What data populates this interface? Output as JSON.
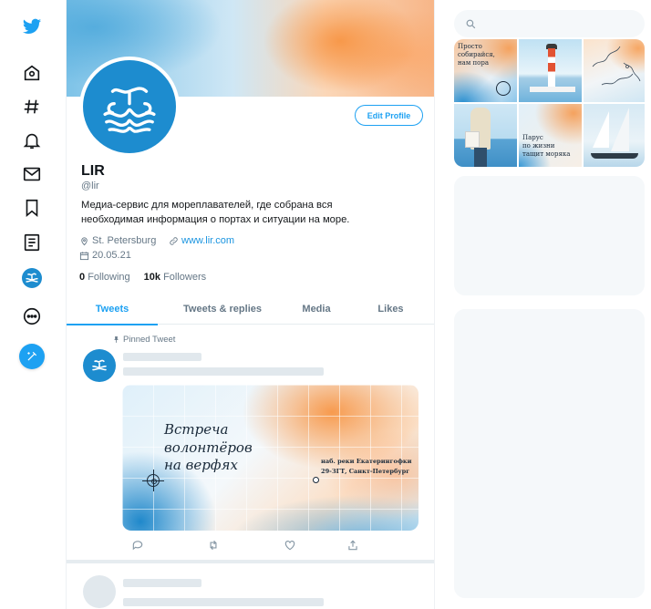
{
  "nav": {
    "items": [
      "twitter-logo",
      "home",
      "explore",
      "notifications",
      "messages",
      "bookmarks",
      "lists",
      "profile",
      "more"
    ],
    "tweet_button_icon": "feather-plus-icon"
  },
  "profile": {
    "name": "LIR",
    "handle": "@lir",
    "bio_line1": "Медиа-сервис для мореплавателей, где собрана вся",
    "bio_line2": "необходимая информация о портах и ситуации на море.",
    "location": "St. Petersburg",
    "website": "www.lir.com",
    "joined": "20.05.21",
    "following_count": "0",
    "following_label": "Following",
    "followers_count": "10k",
    "followers_label": "Followers",
    "edit_label": "Edit Profile"
  },
  "tabs": [
    {
      "label": "Tweets",
      "active": true
    },
    {
      "label": "Tweets & replies",
      "active": false
    },
    {
      "label": "Media",
      "active": false
    },
    {
      "label": "Likes",
      "active": false
    }
  ],
  "pinned": {
    "label": "Pinned Tweet",
    "card": {
      "title_lines": [
        "Встреча",
        "волонтёров",
        "на верфях"
      ],
      "address_lines": [
        "наб. реки Екатерингофки",
        "29-ЗГТ, Санкт-Петербург"
      ]
    },
    "actions": [
      "reply-icon",
      "retweet-icon",
      "like-icon",
      "share-icon"
    ]
  },
  "sidebar": {
    "search_placeholder": "",
    "media": [
      {
        "text_lines": [
          "Просто",
          "собирайся,",
          "нам пора"
        ]
      },
      {
        "text_lines": []
      },
      {
        "text_lines": []
      },
      {
        "text_lines": []
      },
      {
        "text_lines": [
          "Парус",
          "по жизни",
          "тащит моряка"
        ]
      },
      {
        "text_lines": []
      }
    ]
  },
  "colors": {
    "accent": "#1da1f2",
    "brand_blue": "#1d8ccf",
    "muted": "#657786",
    "skeleton": "#e1e8ed",
    "panel": "#f5f8fa"
  }
}
